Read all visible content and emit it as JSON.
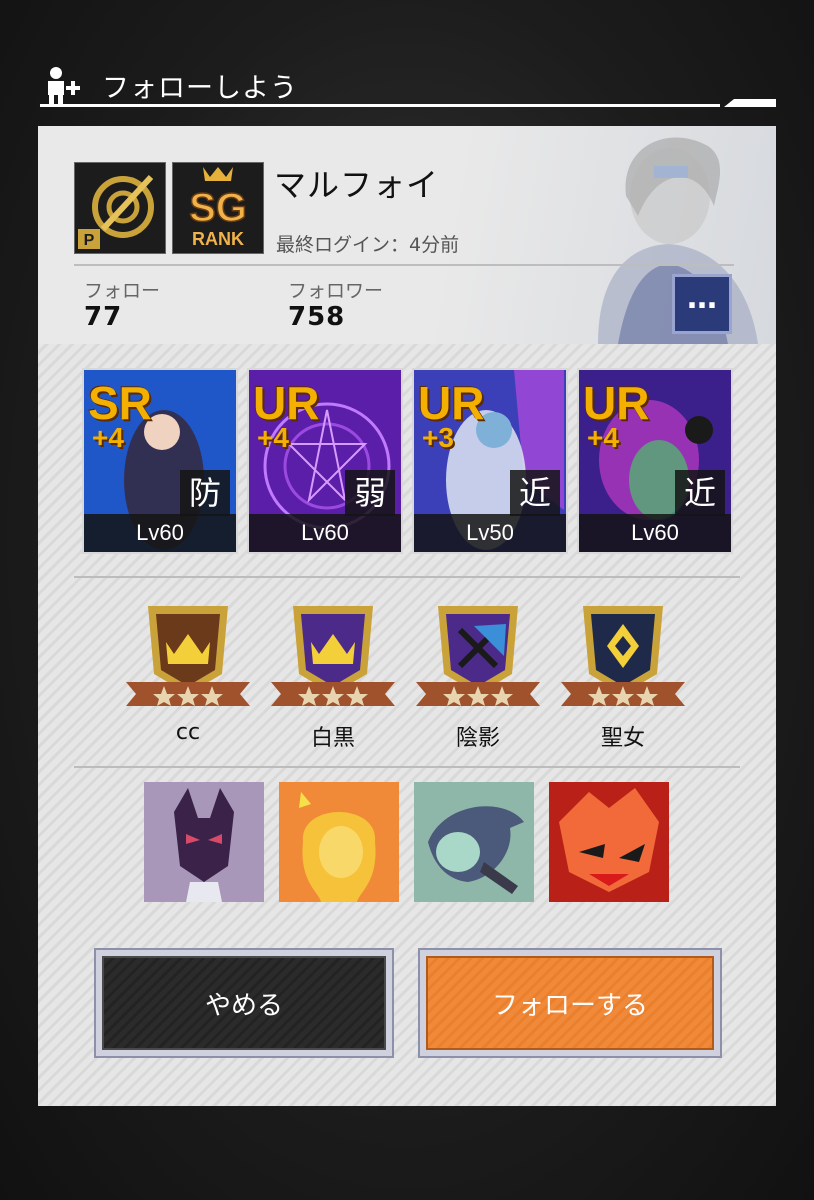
{
  "header": {
    "title": "フォローしよう"
  },
  "profile": {
    "badge_p_letter": "P",
    "rank_badge": {
      "rank": "SG",
      "label": "RANK"
    },
    "username": "マルフォイ",
    "last_login": "最終ログイン：4分前",
    "follow_label": "フォロー",
    "follow_count": "77",
    "follower_label": "フォロワー",
    "follower_count": "758",
    "more_button": "…"
  },
  "units": [
    {
      "rarity": "SR",
      "plus": "+4",
      "attribute": "防",
      "level": "Lv60",
      "theme": "#1f57c9"
    },
    {
      "rarity": "UR",
      "plus": "+4",
      "attribute": "弱",
      "level": "Lv60",
      "theme": "#5b1ea8"
    },
    {
      "rarity": "UR",
      "plus": "+3",
      "attribute": "近",
      "level": "Lv50",
      "theme": "#3b3fb8"
    },
    {
      "rarity": "UR",
      "plus": "+4",
      "attribute": "近",
      "level": "Lv60",
      "theme": "#3b1f8a"
    }
  ],
  "emblems": [
    {
      "label": "cc",
      "icon": "crown-icon",
      "color": "#6a3a1a"
    },
    {
      "label": "白黒",
      "icon": "crown-icon",
      "color": "#4b2a8a"
    },
    {
      "label": "陰影",
      "icon": "crossed-swords-icon",
      "color": "#4b2a8a"
    },
    {
      "label": "聖女",
      "icon": "diamond-emblem-icon",
      "color": "#1f2a4a"
    }
  ],
  "avatars": [
    {
      "name": "fox-mask-avatar",
      "bg": "#a897b8"
    },
    {
      "name": "blonde-hair-avatar",
      "bg": "#f08a38"
    },
    {
      "name": "goblin-avatar",
      "bg": "#8fb7a9"
    },
    {
      "name": "red-beast-avatar",
      "bg": "#b82018"
    }
  ],
  "actions": {
    "cancel": "やめる",
    "follow": "フォローする"
  }
}
